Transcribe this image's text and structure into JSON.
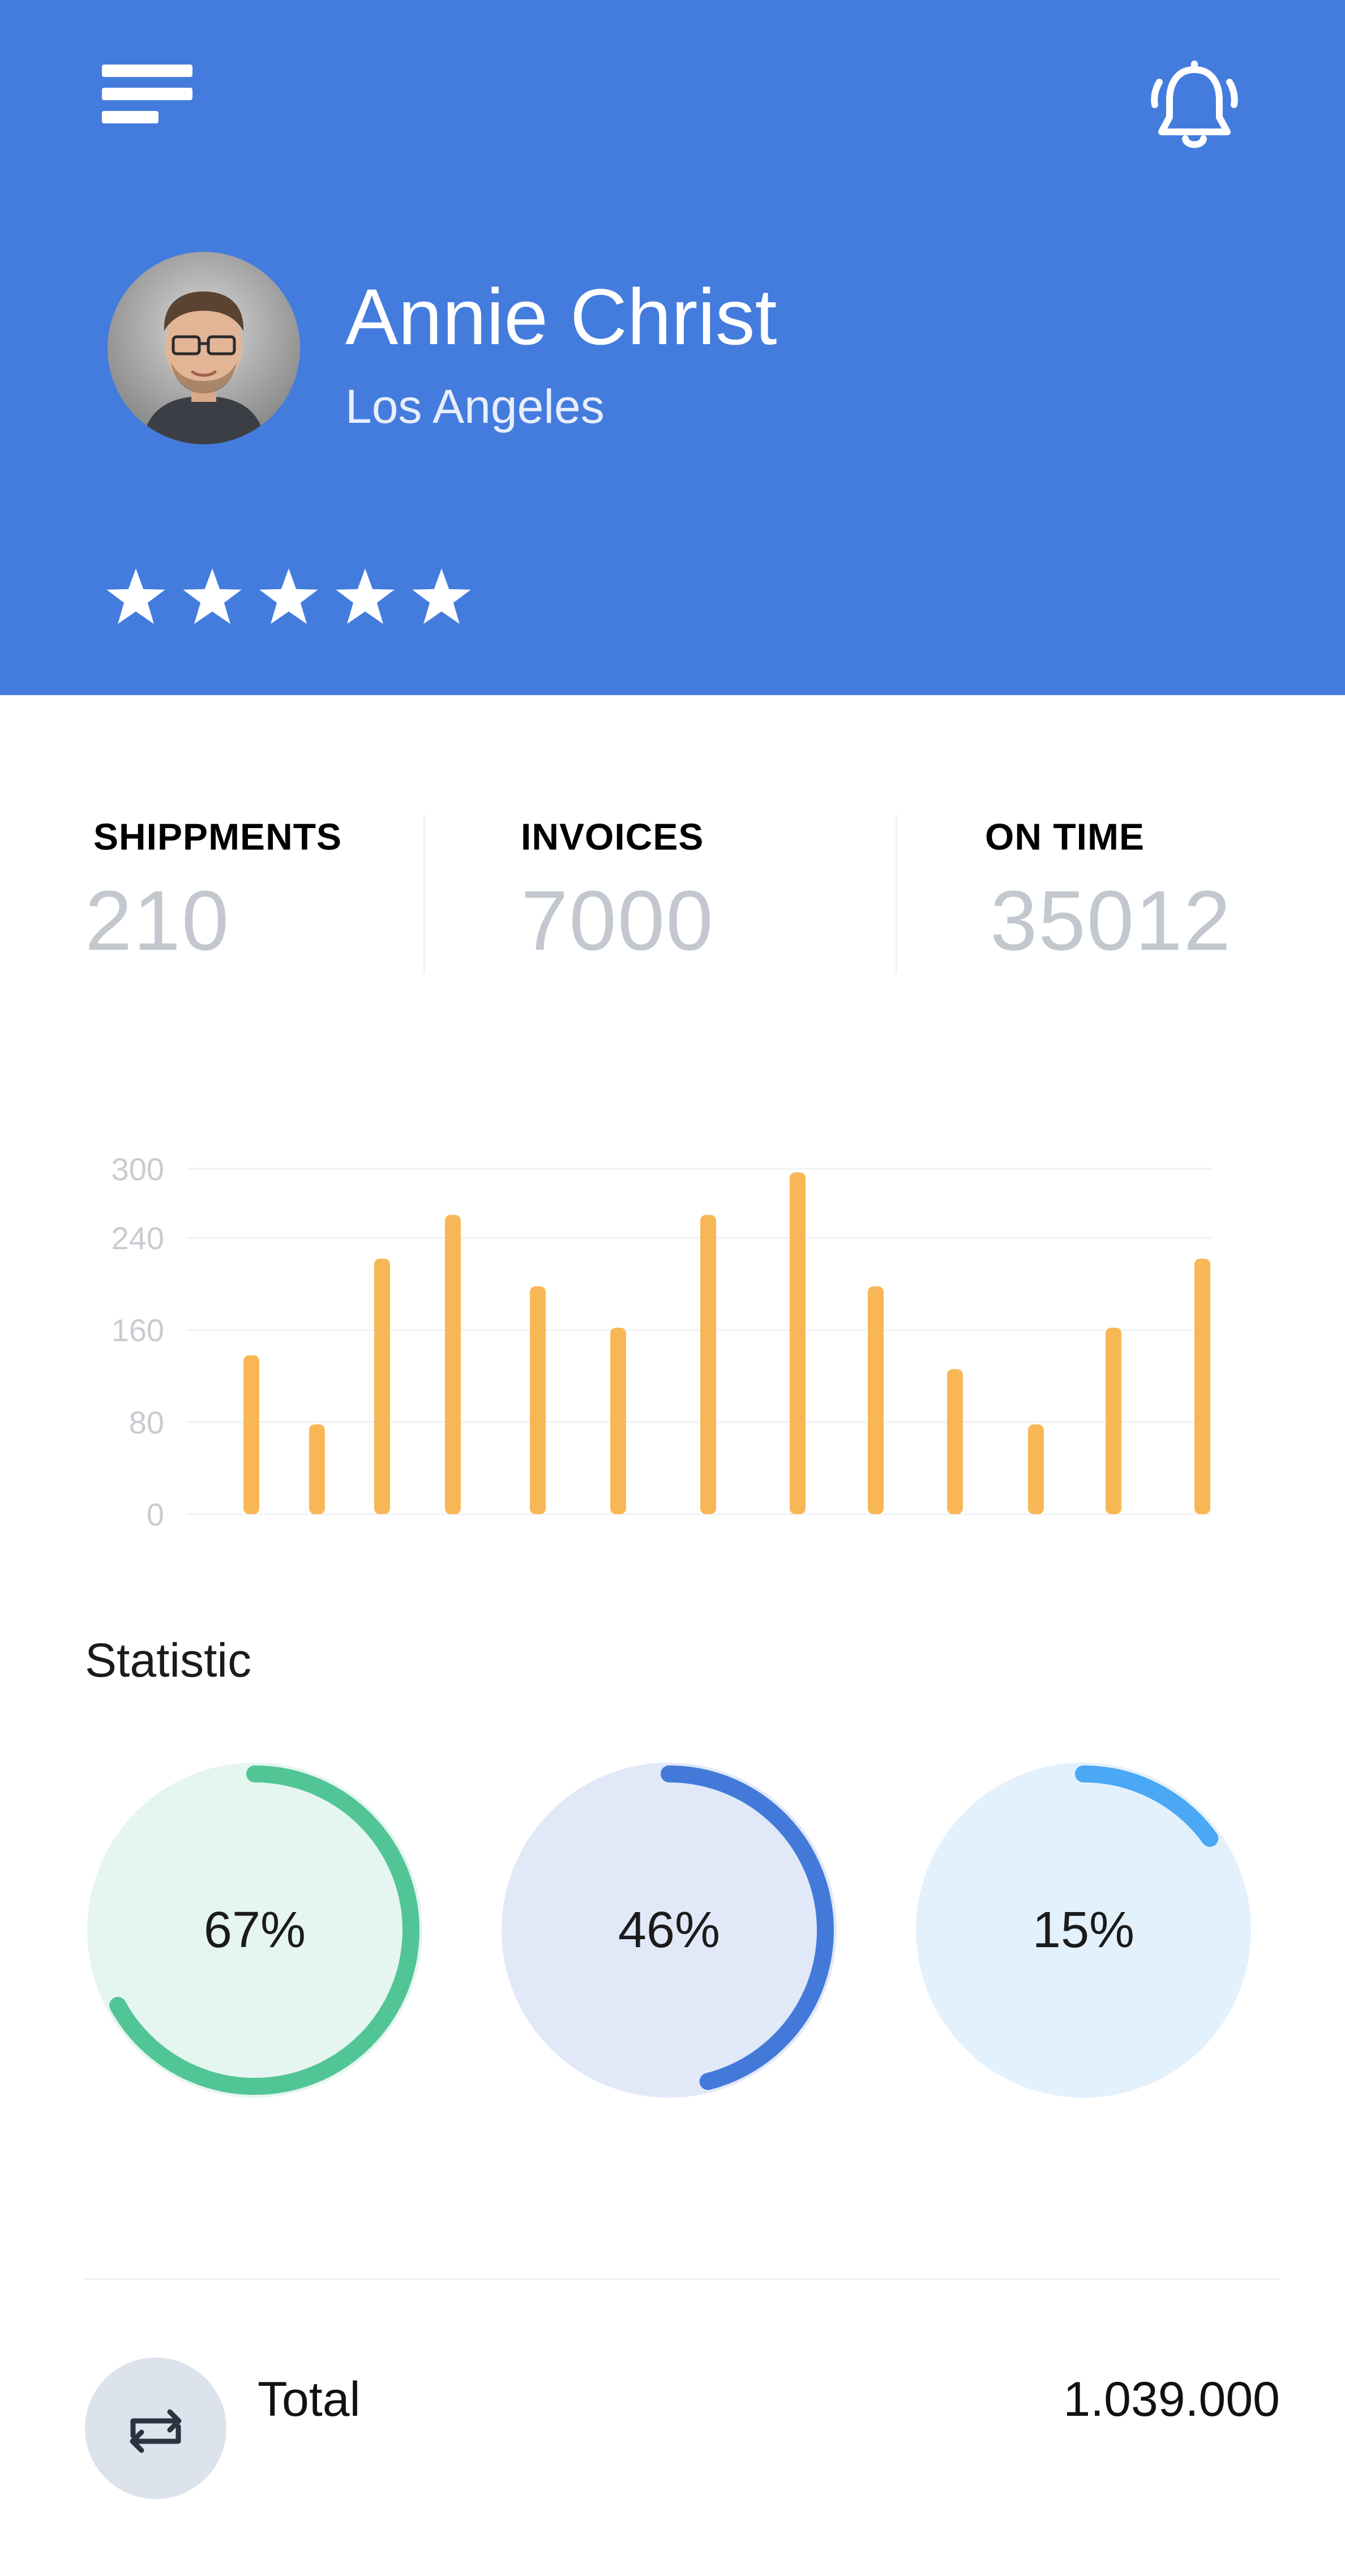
{
  "profile": {
    "name": "Annie Christ",
    "location": "Los Angeles",
    "rating": 5
  },
  "stats": [
    {
      "label": "SHIPPMENTS",
      "value": "210"
    },
    {
      "label": "INVOICES",
      "value": "7000"
    },
    {
      "label": "ON TIME",
      "value": "35012"
    }
  ],
  "chart_data": {
    "type": "bar",
    "values": [
      138,
      78,
      222,
      260,
      198,
      162,
      260,
      297,
      198,
      126,
      78,
      162,
      222
    ],
    "y_ticks": [
      "300",
      "240",
      "160",
      "80",
      "0"
    ],
    "ylim": [
      0,
      300
    ],
    "grid": true,
    "bar_color": "#F8B757"
  },
  "statistic": {
    "title": "Statistic",
    "items": [
      {
        "label": "67%",
        "percent": 67,
        "color": "#52C596",
        "track": "#E5F5EF"
      },
      {
        "label": "46%",
        "percent": 46,
        "color": "#437ADA",
        "track": "#E1E8F8"
      },
      {
        "label": "15%",
        "percent": 15,
        "color": "#4AA8F5",
        "track": "#E3F1FD"
      }
    ]
  },
  "total": {
    "label": "Total",
    "value": "1.039.000",
    "icon": "repeat-icon"
  },
  "colors": {
    "header": "#447CDE",
    "muted_value": "#C3C7CE"
  },
  "icons": {
    "menu": "menu-icon",
    "bell": "bell-icon",
    "star": "star-icon"
  }
}
